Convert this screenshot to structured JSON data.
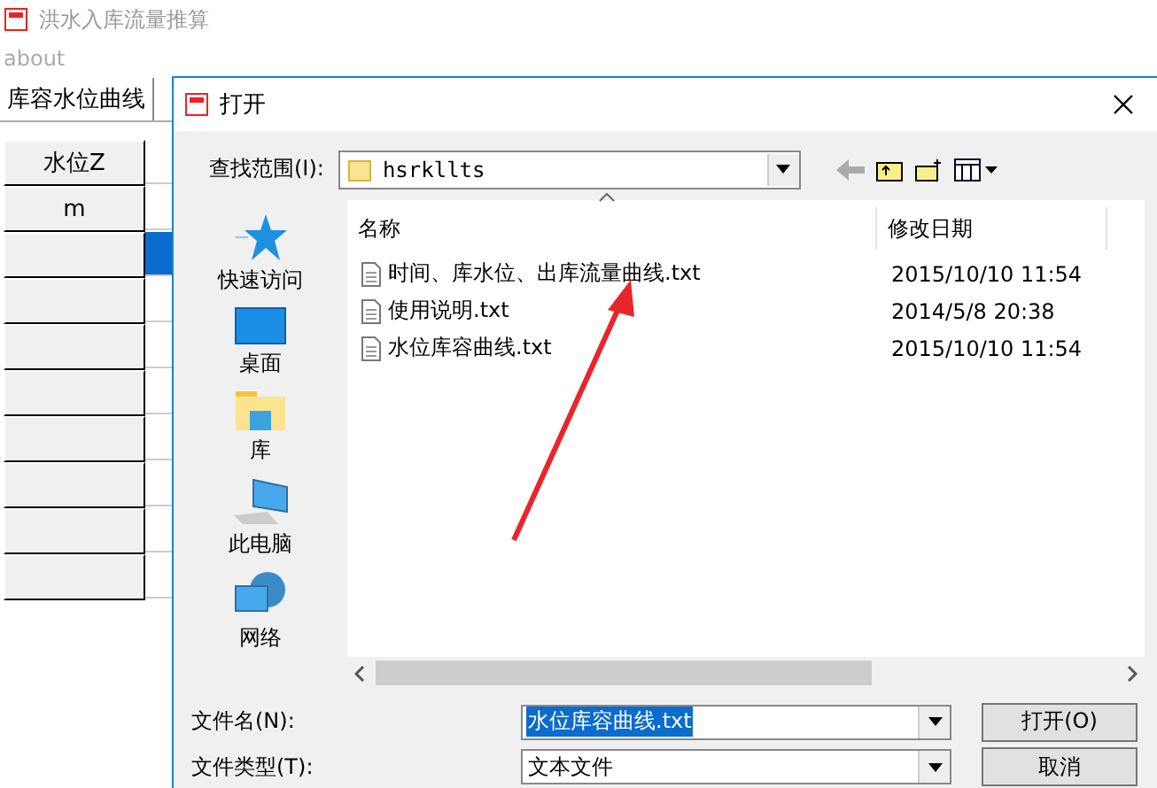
{
  "app": {
    "title": "洪水入库流量推算",
    "menu": [
      "about"
    ],
    "tabs": [
      {
        "label": "库容水位曲线",
        "selected": true
      }
    ],
    "table": {
      "header": "水位Z",
      "unit": "m",
      "rows": [
        {
          "selected": true
        },
        {
          "selected": false
        },
        {
          "selected": false
        },
        {
          "selected": false
        },
        {
          "selected": false
        },
        {
          "selected": false
        },
        {
          "selected": false
        },
        {
          "selected": false
        }
      ]
    }
  },
  "dialog": {
    "title": "打开",
    "look_in_label": "查找范围(I):",
    "look_in_value": "hsrkllts",
    "places": [
      {
        "label": "快速访问",
        "kind": "star"
      },
      {
        "label": "桌面",
        "kind": "desktop"
      },
      {
        "label": "库",
        "kind": "library"
      },
      {
        "label": "此电脑",
        "kind": "computer"
      },
      {
        "label": "网络",
        "kind": "network"
      }
    ],
    "columns": [
      {
        "label": "名称",
        "sorted": true
      },
      {
        "label": "修改日期",
        "sorted": false
      }
    ],
    "files": [
      {
        "name": "时间、库水位、出库流量曲线.txt",
        "modified": "2015/10/10 11:54"
      },
      {
        "name": "使用说明.txt",
        "modified": "2014/5/8 20:38"
      },
      {
        "name": "水位库容曲线.txt",
        "modified": "2015/10/10 11:54"
      }
    ],
    "filename": {
      "label": "文件名(N):",
      "value": "水位库容曲线.txt",
      "selected": true
    },
    "filetype": {
      "label": "文件类型(T):",
      "value": "文本文件"
    },
    "buttons": [
      "打开(O)",
      "取消"
    ]
  },
  "annotation": {
    "kind": "arrow"
  }
}
